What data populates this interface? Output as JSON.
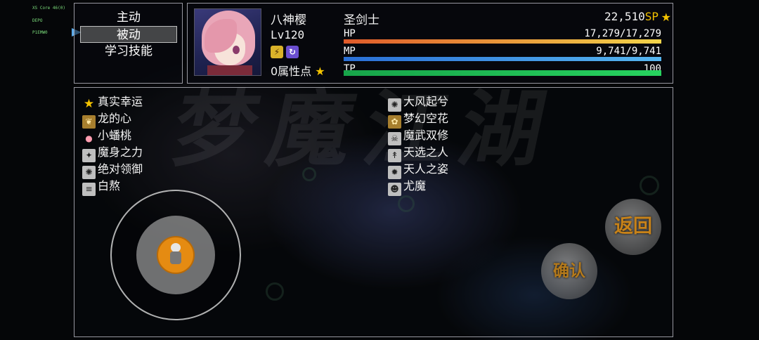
{
  "debug": [
    "XS Core 46(0)",
    "DEPO",
    "P1EMW0"
  ],
  "background": {
    "title": "梦魔江湖"
  },
  "menu": {
    "items": [
      {
        "label": "主动",
        "selected": false
      },
      {
        "label": "被动",
        "selected": true
      },
      {
        "label": "学习技能",
        "selected": false
      }
    ]
  },
  "status": {
    "name": "八神樱",
    "class_title": "圣剑士",
    "level": "Lv120",
    "sp_value": "22,510",
    "sp_unit": "SP",
    "attribute_points": "0属性点",
    "state_icons": [
      "slash-icon",
      "swirl-icon"
    ],
    "gauges": [
      {
        "label": "HP",
        "value_text": "17,279/17,279",
        "fill": 1.0,
        "color_from": "#e05a2a",
        "color_to": "#f2d44a"
      },
      {
        "label": "MP",
        "value_text": "9,741/9,741",
        "fill": 1.0,
        "color_from": "#2a6fd6",
        "color_to": "#56b6f0"
      },
      {
        "label": "TP",
        "value_text": "100",
        "fill": 1.0,
        "color_from": "#17a44a",
        "color_to": "#27d35f"
      }
    ]
  },
  "skills": {
    "left": [
      {
        "label": "真实幸运",
        "icon": "star-icon"
      },
      {
        "label": "龙的心",
        "icon": "dragon-heart-icon"
      },
      {
        "label": "小蟠桃",
        "icon": "peach-icon"
      },
      {
        "label": "魔身之力",
        "icon": "demon-body-icon"
      },
      {
        "label": "绝对领御",
        "icon": "barrier-icon"
      },
      {
        "label": "白熬",
        "icon": "scroll-icon"
      }
    ],
    "right": [
      {
        "label": "大风起兮",
        "icon": "wind-icon"
      },
      {
        "label": "梦幻空花",
        "icon": "flower-icon"
      },
      {
        "label": "魔武双修",
        "icon": "skull-icon"
      },
      {
        "label": "天选之人",
        "icon": "chosen-icon"
      },
      {
        "label": "天人之姿",
        "icon": "celestial-icon"
      },
      {
        "label": "尤魔",
        "icon": "demon-face-icon"
      }
    ]
  },
  "controls": {
    "back_label": "返回",
    "confirm_label": "确认"
  }
}
